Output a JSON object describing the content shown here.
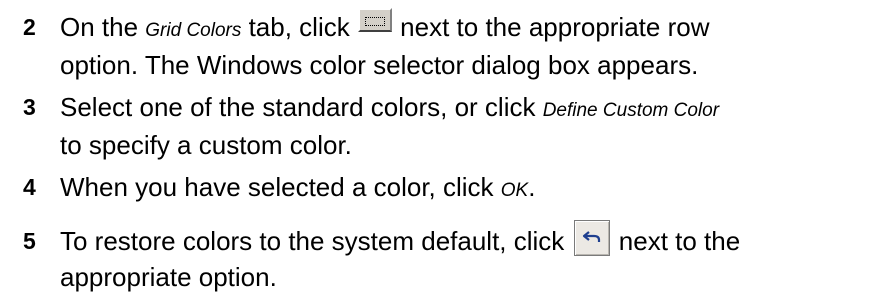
{
  "steps": [
    {
      "number": "2",
      "text_a": "On the ",
      "text_tab": "Grid Colors",
      "text_b": " tab, click ",
      "button_icon": "ellipsis-button-icon",
      "text_c": " next to the appropriate row",
      "text_d": "option.  The Windows color selector dialog box appears."
    },
    {
      "number": "3",
      "text_a": "Select one of the standard colors, or click ",
      "text_link": "Define Custom Color",
      "text_b": "to specify a custom color."
    },
    {
      "number": "4",
      "text_a": "When you have selected a color, click ",
      "text_ok": "OK",
      "text_b": "."
    },
    {
      "number": "5",
      "text_a": "To restore colors to the system default, click ",
      "button_icon": "undo-arrow-icon",
      "text_b": " next to the",
      "text_c": "appropriate option."
    }
  ],
  "colors": {
    "text": "#000000",
    "button_face": "#d4d0c8",
    "undo_arrow": "#1f3f8f"
  }
}
